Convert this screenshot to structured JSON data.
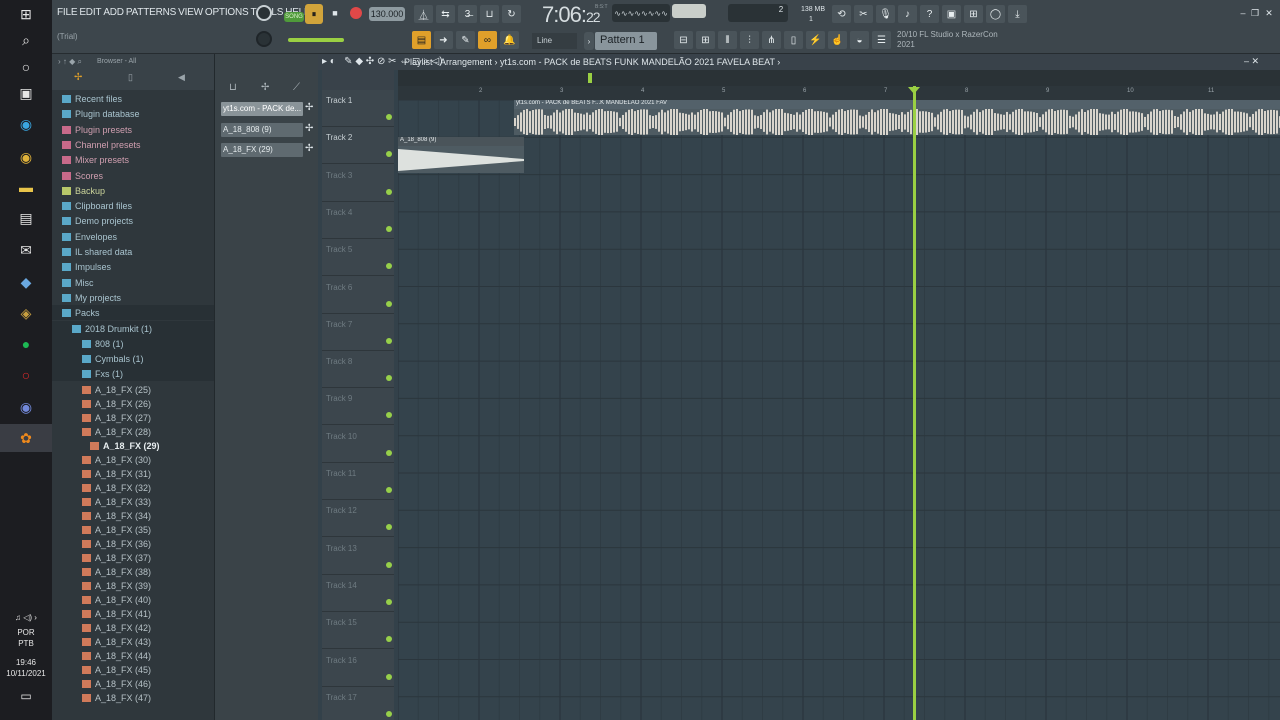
{
  "menu": [
    "FILE",
    "EDIT",
    "ADD",
    "PATTERNS",
    "VIEW",
    "OPTIONS",
    "TOOLS",
    "HELP"
  ],
  "trial_label": "(Trial)",
  "transport": {
    "mode": "SONG",
    "tempo": "130.000",
    "time_main": "7:06",
    "time_sub": "22",
    "time_tag": "B:S:T"
  },
  "memory": {
    "value": "138 MB",
    "voices": "2",
    "cpu": "1"
  },
  "pattern_label": "Pattern 1",
  "snap_label": "Line",
  "hint": {
    "line1": "20/10  FL Studio x RazerCon",
    "line2": "2021"
  },
  "browser": {
    "title": "Browser - All",
    "items": [
      {
        "label": "Recent files",
        "type": "blue"
      },
      {
        "label": "Plugin database",
        "type": "blue"
      },
      {
        "label": "Plugin presets",
        "type": "red"
      },
      {
        "label": "Channel presets",
        "type": "red"
      },
      {
        "label": "Mixer presets",
        "type": "red"
      },
      {
        "label": "Scores",
        "type": "red"
      },
      {
        "label": "Backup",
        "type": "yel"
      },
      {
        "label": "Clipboard files",
        "type": "blue"
      },
      {
        "label": "Demo projects",
        "type": "blue"
      },
      {
        "label": "Envelopes",
        "type": "blue"
      },
      {
        "label": "IL shared data",
        "type": "blue"
      },
      {
        "label": "Impulses",
        "type": "blue"
      },
      {
        "label": "Misc",
        "type": "blue"
      },
      {
        "label": "My projects",
        "type": "blue"
      },
      {
        "label": "Packs",
        "type": "blue"
      },
      {
        "label": "2018 Drumkit (1)",
        "type": "blue"
      },
      {
        "label": "808 (1)",
        "type": "blue"
      },
      {
        "label": "Cymbals (1)",
        "type": "blue"
      },
      {
        "label": "Fxs (1)",
        "type": "blue"
      }
    ],
    "files": [
      "A_18_FX (25)",
      "A_18_FX (26)",
      "A_18_FX (27)",
      "A_18_FX (28)",
      "A_18_FX (29)",
      "A_18_FX (30)",
      "A_18_FX (31)",
      "A_18_FX (32)",
      "A_18_FX (33)",
      "A_18_FX (34)",
      "A_18_FX (35)",
      "A_18_FX (36)",
      "A_18_FX (37)",
      "A_18_FX (38)",
      "A_18_FX (39)",
      "A_18_FX (40)",
      "A_18_FX (41)",
      "A_18_FX (42)",
      "A_18_FX (43)",
      "A_18_FX (44)",
      "A_18_FX (45)",
      "A_18_FX (46)",
      "A_18_FX (47)"
    ]
  },
  "channels": [
    "yt1s.com - PACK de...",
    "A_18_808 (9)",
    "A_18_FX (29)"
  ],
  "playlist": {
    "crumb": "Playlist - Arrangement  ›  yt1s.com - PACK  de BEATS FUNK MANDELÃO 2021  FAVELA BEAT  ›",
    "tracks": [
      "Track 1",
      "Track 2",
      "Track 3",
      "Track 4",
      "Track 5",
      "Track 6",
      "Track 7",
      "Track 8",
      "Track 9",
      "Track 10",
      "Track 11",
      "Track 12",
      "Track 13",
      "Track 14",
      "Track 15",
      "Track 16",
      "Track 17"
    ],
    "ruler": [
      "2",
      "3",
      "4",
      "5",
      "6",
      "7",
      "8",
      "9",
      "10",
      "11"
    ],
    "clip1_label": "yt1s.com - PACK  de BEATS F...K MANDELÃO 2021  FAV",
    "clip1_tail": "yt1s.com - PACK...2021  FAVELA BEAT",
    "clip2_label": "A_18_808 (9)"
  },
  "tray": {
    "lang": "POR",
    "kb": "PTB",
    "clock": "19:46",
    "date": "10/11/2021"
  }
}
